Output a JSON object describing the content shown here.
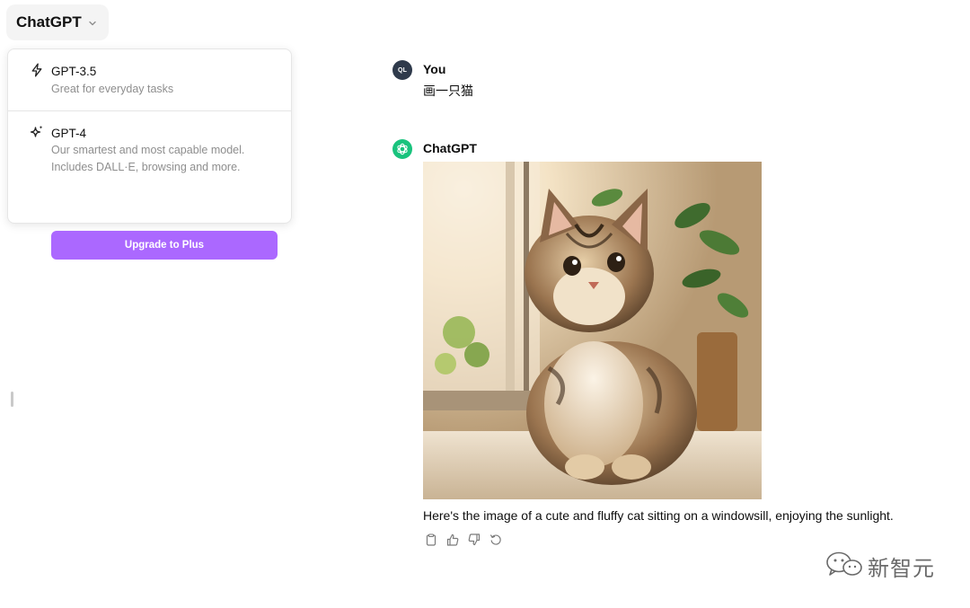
{
  "header": {
    "model_selector_label": "ChatGPT"
  },
  "dropdown": {
    "options": [
      {
        "name": "GPT-3.5",
        "description": "Great for everyday tasks",
        "icon": "lightning-icon"
      },
      {
        "name": "GPT-4",
        "description": "Our smartest and most capable model. Includes DALL·E, browsing and more.",
        "icon": "sparkle-icon"
      }
    ],
    "upgrade_label": "Upgrade to Plus"
  },
  "conversation": {
    "user": {
      "name": "You",
      "avatar_initials": "QL",
      "message": "画一只猫"
    },
    "assistant": {
      "name": "ChatGPT",
      "message": "Here's the image of a cute and fluffy cat sitting on a windowsill, enjoying the sunlight.",
      "image_icon": "generated-cat-image"
    }
  },
  "actions": [
    "copy-icon",
    "thumbs-up-icon",
    "thumbs-down-icon",
    "regenerate-icon"
  ],
  "watermark": {
    "text": "新智元"
  },
  "colors": {
    "upgrade_button": "#ab68ff",
    "assistant_avatar": "#19c37d",
    "user_avatar": "#2f3a4b"
  }
}
